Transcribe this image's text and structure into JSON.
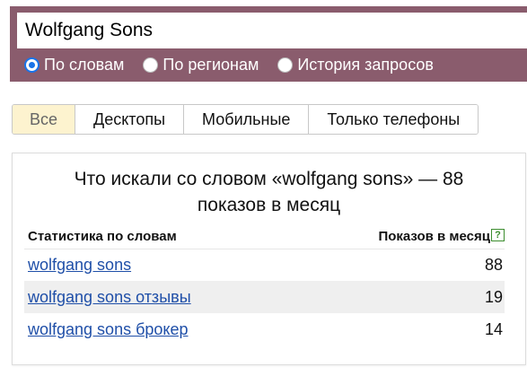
{
  "search": {
    "query": "Wolfgang Sons"
  },
  "modes": [
    {
      "label": "По словам",
      "checked": true
    },
    {
      "label": "По регионам",
      "checked": false
    },
    {
      "label": "История запросов",
      "checked": false
    }
  ],
  "tabs": [
    {
      "label": "Все",
      "active": true
    },
    {
      "label": "Десктопы",
      "active": false
    },
    {
      "label": "Мобильные",
      "active": false
    },
    {
      "label": "Только телефоны",
      "active": false
    }
  ],
  "stats": {
    "title_line1": "Что искали со словом «wolfgang sons» — 88",
    "title_line2": "показов в месяц",
    "col_phrase": "Статистика по словам",
    "col_count": "Показов в месяц",
    "help_glyph": "?",
    "rows": [
      {
        "phrase": "wolfgang sons",
        "count": "88"
      },
      {
        "phrase": "wolfgang sons отзывы",
        "count": "19"
      },
      {
        "phrase": "wolfgang sons брокер",
        "count": "14"
      }
    ]
  },
  "colors": {
    "header_bg": "#8a5c6d",
    "link": "#1f4fa8",
    "active_tab": "#fdf3cf",
    "help_icon": "#3c8d2f"
  }
}
